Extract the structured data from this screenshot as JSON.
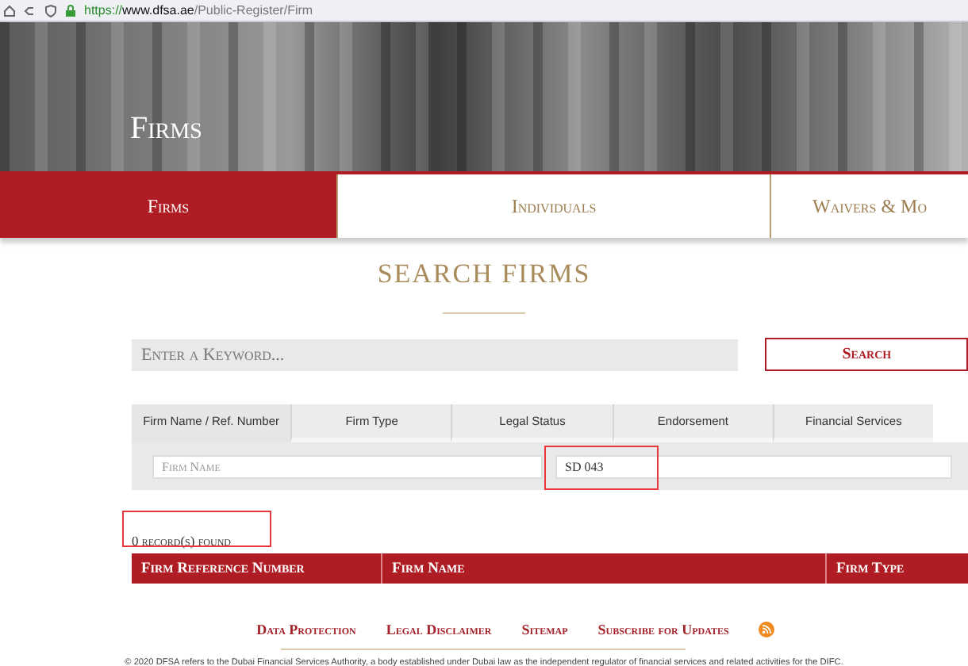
{
  "browser": {
    "url_host": "https://www.dfsa.ae",
    "url_path": "/Public-Register/Firm"
  },
  "banner": {
    "title": "Firms"
  },
  "nav_tabs": [
    {
      "label": "Firms",
      "selected": true
    },
    {
      "label": "Individuals",
      "selected": false
    },
    {
      "label": "Waivers & Mo",
      "selected": false
    }
  ],
  "heading": "SEARCH FIRMS",
  "search": {
    "placeholder": "Enter a Keyword...",
    "button": "Search"
  },
  "filter_tabs": [
    {
      "label": "Firm Name / Ref. Number",
      "selected": true
    },
    {
      "label": "Firm Type",
      "selected": false
    },
    {
      "label": "Legal Status",
      "selected": false
    },
    {
      "label": "Endorsement",
      "selected": false
    },
    {
      "label": "Financial Services",
      "selected": false
    }
  ],
  "filter_fields": [
    {
      "placeholder": "Firm Name",
      "highlighted": false
    },
    {
      "value": "SD 043",
      "highlighted": true
    }
  ],
  "results": {
    "count": "0 record(s) found",
    "highlighted": true,
    "columns": [
      "Firm Reference Number",
      "Firm Name",
      "Firm Type"
    ]
  },
  "footer": {
    "links": [
      "Data Protection",
      "Legal Disclaimer",
      "Sitemap",
      "Subscribe for Updates"
    ],
    "copyright": "© 2020 DFSA refers to the Dubai Financial Services Authority, a body established under Dubai law as the independent regulator of financial services and related activities for the DIFC."
  }
}
